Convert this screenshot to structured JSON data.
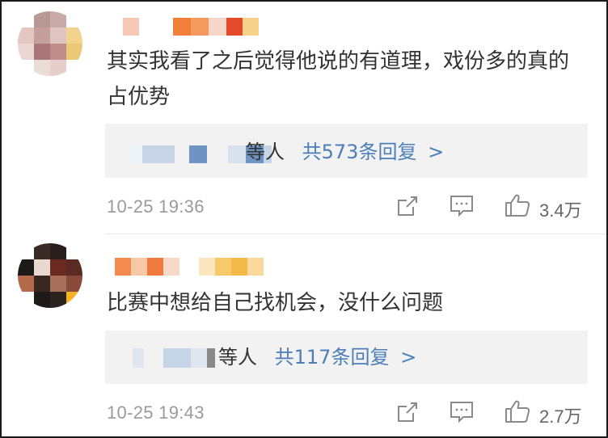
{
  "comments": [
    {
      "text": "其实我看了之后觉得他说的有道理，戏份多的真的占优势",
      "reply_suffix": "等人",
      "reply_link": "共573条回复",
      "reply_chevron": ">",
      "time": "10-25 19:36",
      "likes": "3.4万"
    },
    {
      "text": "比赛中想给自己找机会，没什么问题",
      "reply_suffix": "等人",
      "reply_link": "共117条回复",
      "reply_chevron": ">",
      "time": "10-25 19:43",
      "likes": "2.7万"
    }
  ],
  "icons": {
    "share": "share-icon",
    "comment": "comment-icon",
    "like": "like-icon"
  },
  "colors": {
    "link": "#4c7fb8",
    "text": "#333333",
    "meta": "#9a9a9a",
    "reply_bg": "#f2f2f2"
  }
}
